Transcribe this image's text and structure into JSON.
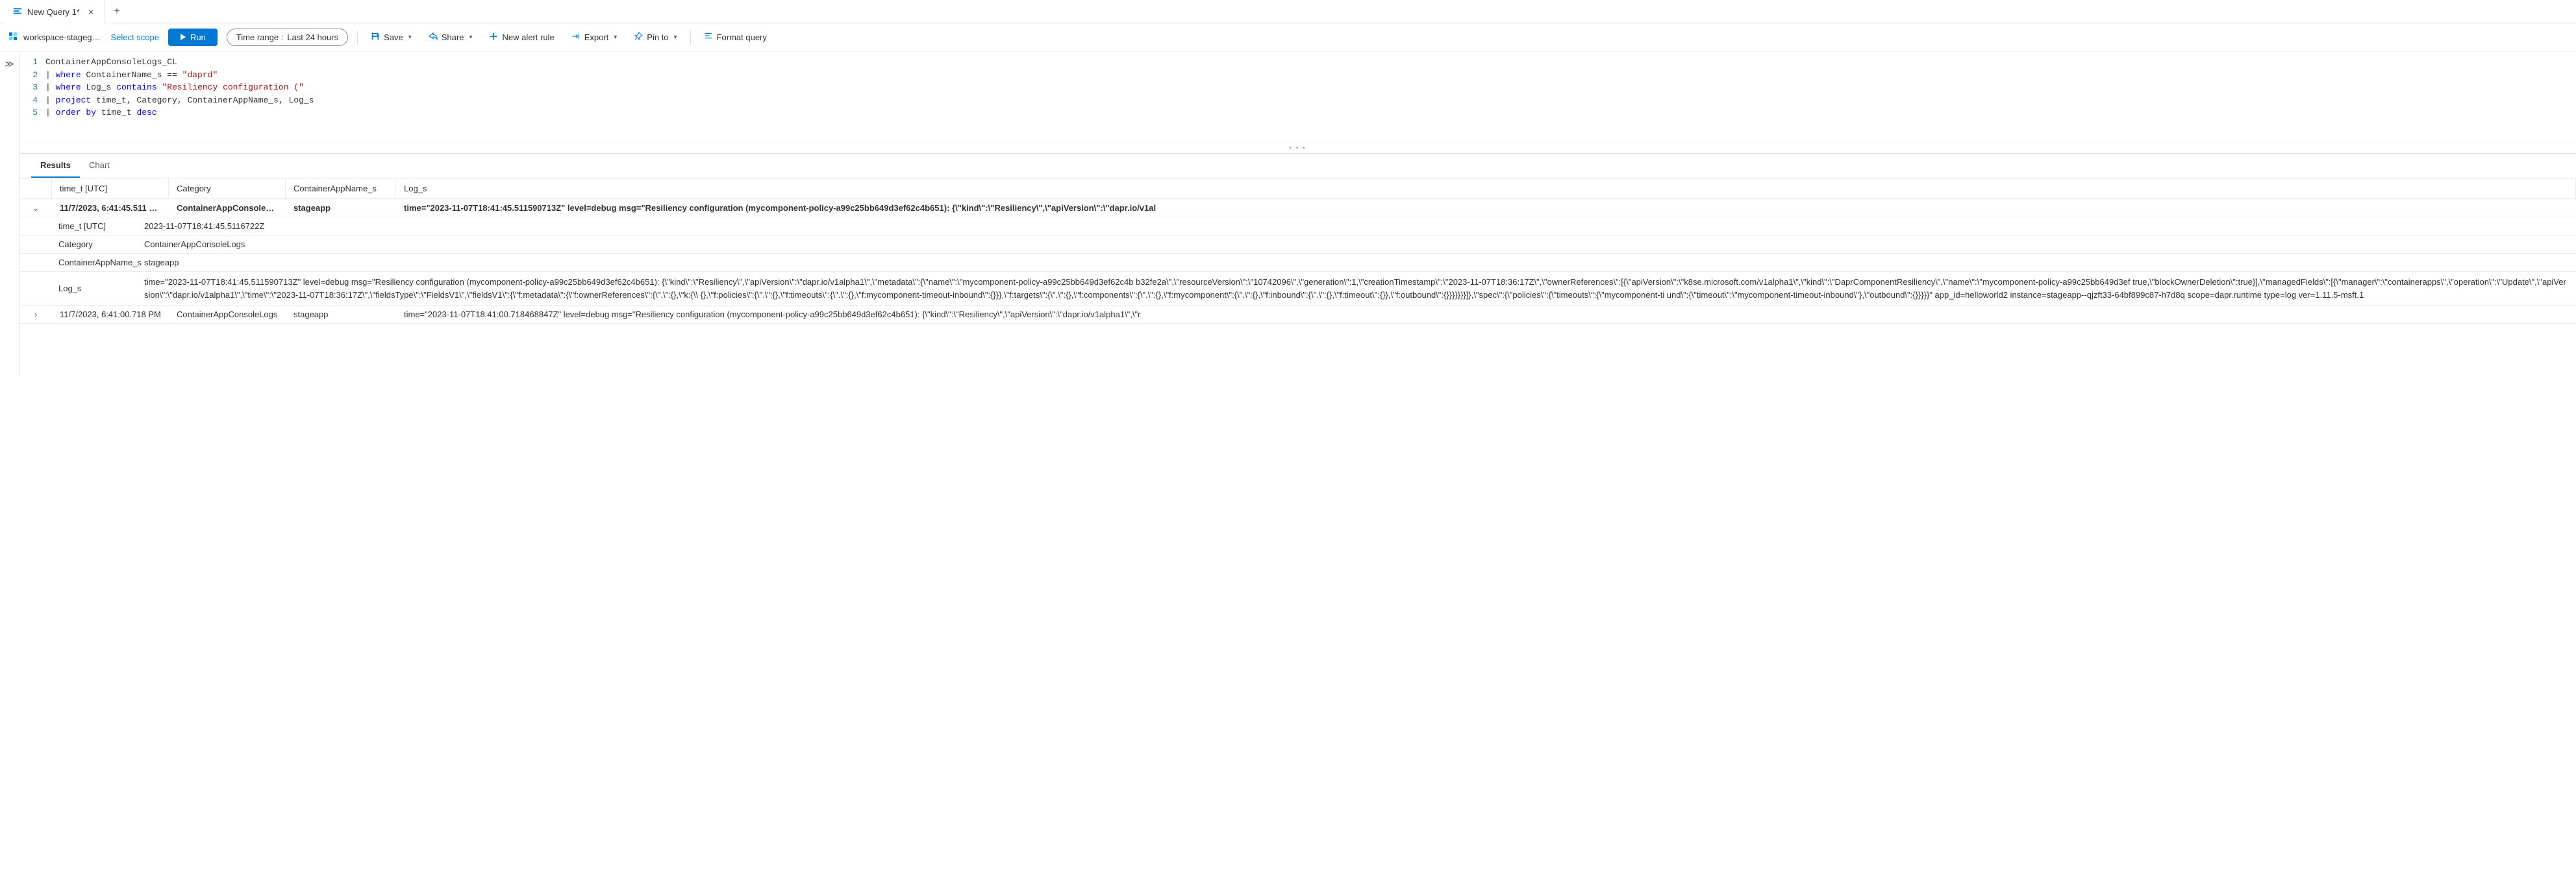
{
  "tabs": {
    "active": "New Query 1*",
    "add_tooltip": "+"
  },
  "toolbar": {
    "workspace_name": "workspace-stageg…",
    "select_scope": "Select scope",
    "run_label": "Run",
    "time_range_label": "Time range :",
    "time_range_value": "Last 24 hours",
    "save_label": "Save",
    "share_label": "Share",
    "new_alert_label": "New alert rule",
    "export_label": "Export",
    "pin_label": "Pin to",
    "format_label": "Format query"
  },
  "editor": {
    "lines": [
      {
        "num": "1",
        "tokens": [
          {
            "t": "identifier",
            "v": "ContainerAppConsoleLogs_CL"
          }
        ]
      },
      {
        "num": "2",
        "tokens": [
          {
            "t": "pipe",
            "v": "| "
          },
          {
            "t": "keyword",
            "v": "where"
          },
          {
            "t": "plain",
            "v": " ContainerName_s == "
          },
          {
            "t": "string",
            "v": "\"daprd\""
          }
        ]
      },
      {
        "num": "3",
        "tokens": [
          {
            "t": "pipe",
            "v": "| "
          },
          {
            "t": "keyword",
            "v": "where"
          },
          {
            "t": "plain",
            "v": " Log_s "
          },
          {
            "t": "keyword",
            "v": "contains"
          },
          {
            "t": "plain",
            "v": " "
          },
          {
            "t": "string",
            "v": "\"Resiliency configuration (\""
          }
        ]
      },
      {
        "num": "4",
        "tokens": [
          {
            "t": "pipe",
            "v": "| "
          },
          {
            "t": "keyword",
            "v": "project"
          },
          {
            "t": "plain",
            "v": " time_t, Category, ContainerAppName_s, Log_s"
          }
        ]
      },
      {
        "num": "5",
        "tokens": [
          {
            "t": "pipe",
            "v": "| "
          },
          {
            "t": "keyword",
            "v": "order by"
          },
          {
            "t": "plain",
            "v": " time_t "
          },
          {
            "t": "keyword",
            "v": "desc"
          }
        ]
      }
    ]
  },
  "results": {
    "tabs": {
      "results": "Results",
      "chart": "Chart"
    },
    "columns": {
      "time": "time_t [UTC]",
      "category": "Category",
      "appname": "ContainerAppName_s",
      "log": "Log_s"
    },
    "rows": [
      {
        "expanded": true,
        "time": "11/7/2023, 6:41:45.511 …",
        "category": "ContainerAppConsoleLogs",
        "appname": "stageapp",
        "log": "time=\"2023-11-07T18:41:45.511590713Z\" level=debug msg=\"Resiliency configuration (mycomponent-policy-a99c25bb649d3ef62c4b651): {\\\"kind\\\":\\\"Resiliency\\\",\\\"apiVersion\\\":\\\"dapr.io/v1al",
        "details": {
          "time_t_label": "time_t [UTC]",
          "time_t_value": "2023-11-07T18:41:45.5116722Z",
          "category_label": "Category",
          "category_value": "ContainerAppConsoleLogs",
          "appname_label": "ContainerAppName_s",
          "appname_value": "stageapp",
          "log_label": "Log_s",
          "log_value": "time=\"2023-11-07T18:41:45.511590713Z\" level=debug msg=\"Resiliency configuration (mycomponent-policy-a99c25bb649d3ef62c4b651): {\\\"kind\\\":\\\"Resiliency\\\",\\\"apiVersion\\\":\\\"dapr.io/v1alpha1\\\",\\\"metadata\\\":{\\\"name\\\":\\\"mycomponent-policy-a99c25bb649d3ef62c4b b32fe2a\\\",\\\"resourceVersion\\\":\\\"10742096\\\",\\\"generation\\\":1,\\\"creationTimestamp\\\":\\\"2023-11-07T18:36:17Z\\\",\\\"ownerReferences\\\":[{\\\"apiVersion\\\":\\\"k8se.microsoft.com/v1alpha1\\\",\\\"kind\\\":\\\"DaprComponentResiliency\\\",\\\"name\\\":\\\"mycomponent-policy-a99c25bb649d3ef true,\\\"blockOwnerDeletion\\\":true}],\\\"managedFields\\\":[{\\\"manager\\\":\\\"containerapps\\\",\\\"operation\\\":\\\"Update\\\",\\\"apiVersion\\\":\\\"dapr.io/v1alpha1\\\",\\\"time\\\":\\\"2023-11-07T18:36:17Z\\\",\\\"fieldsType\\\":\\\"FieldsV1\\\",\\\"fieldsV1\\\":{\\\"f:metadata\\\":{\\\"f:ownerReferences\\\":{\\\".\\\":{},\\\"k:{\\\\ {},\\\"f:policies\\\":{\\\".\\\":{},\\\"f:timeouts\\\":{\\\".\\\":{},\\\"f:mycomponent-timeout-inbound\\\":{}}},\\\"f:targets\\\":{\\\".\\\":{},\\\"f:components\\\":{\\\".\\\":{},\\\"f:mycomponent\\\":{\\\".\\\":{},\\\"f:inbound\\\":{\\\".\\\":{},\\\"f:timeout\\\":{}},\\\"f:outbound\\\":{}}}}}}}]},\\\"spec\\\":{\\\"policies\\\":{\\\"timeouts\\\":{\\\"mycomponent-ti und\\\":{\\\"timeout\\\":\\\"mycomponent-timeout-inbound\\\"},\\\"outbound\\\":{}}}}}\" app_id=helloworld2 instance=stageapp--qjzft33-64bf899c87-h7d8q scope=dapr.runtime type=log ver=1.11.5-msft.1"
        }
      },
      {
        "expanded": false,
        "time": "11/7/2023, 6:41:00.718 PM",
        "category": "ContainerAppConsoleLogs",
        "appname": "stageapp",
        "log": "time=\"2023-11-07T18:41:00.718468847Z\" level=debug msg=\"Resiliency configuration (mycomponent-policy-a99c25bb649d3ef62c4b651): {\\\"kind\\\":\\\"Resiliency\\\",\\\"apiVersion\\\":\\\"dapr.io/v1alpha1\\\",\\\"r"
      }
    ]
  }
}
